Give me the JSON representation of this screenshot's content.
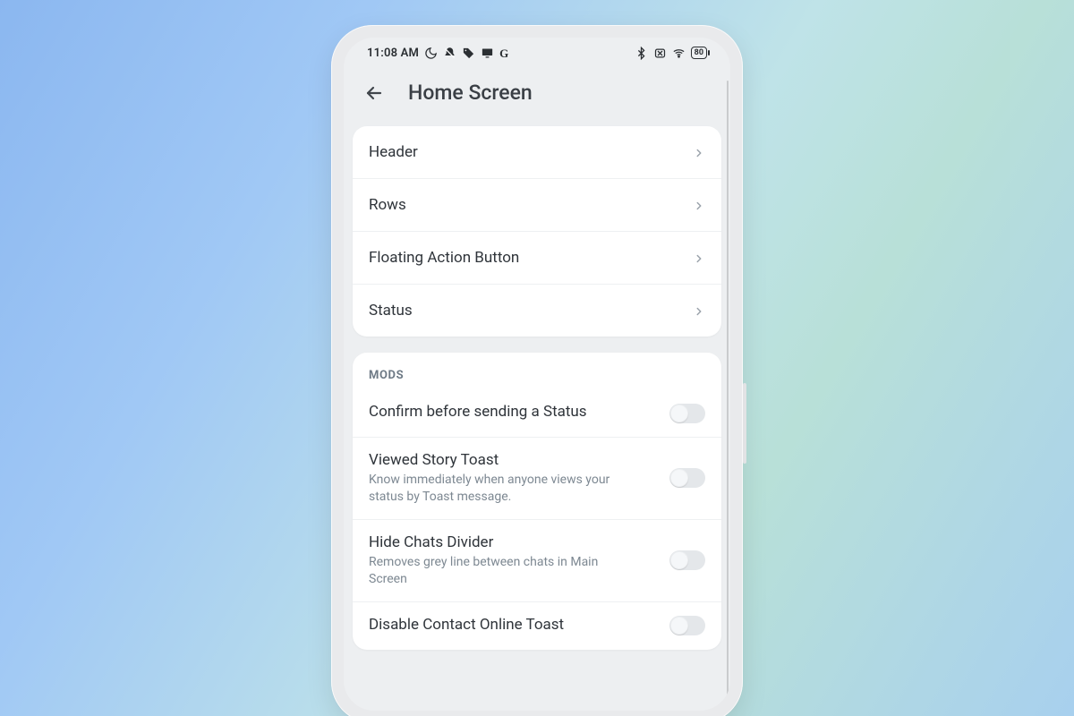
{
  "status_bar": {
    "time": "11:08 AM",
    "battery_percent": "80"
  },
  "app_bar": {
    "title": "Home Screen"
  },
  "nav": {
    "items": [
      {
        "label": "Header"
      },
      {
        "label": "Rows"
      },
      {
        "label": "Floating Action Button"
      },
      {
        "label": "Status"
      }
    ]
  },
  "mods": {
    "section_title": "MODS",
    "items": [
      {
        "title": "Confirm before sending a Status",
        "desc": "",
        "enabled": false
      },
      {
        "title": "Viewed Story Toast",
        "desc": "Know immediately when anyone views your status by Toast message.",
        "enabled": false
      },
      {
        "title": "Hide Chats Divider",
        "desc": "Removes grey line between chats in Main Screen",
        "enabled": false
      },
      {
        "title": "Disable Contact Online Toast",
        "desc": "",
        "enabled": false
      }
    ]
  }
}
